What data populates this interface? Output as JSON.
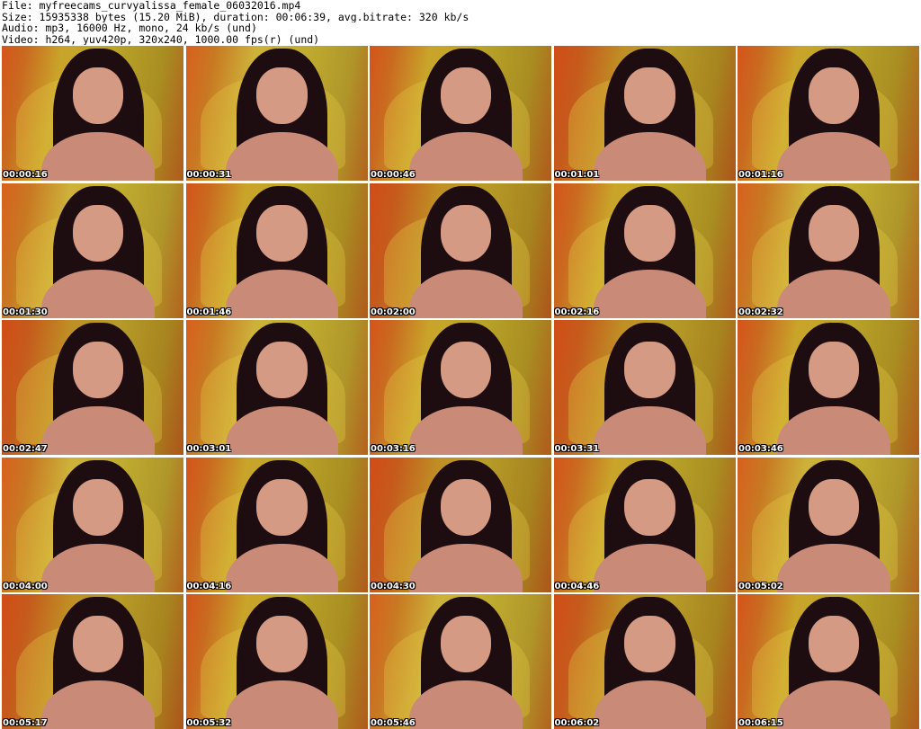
{
  "header": {
    "file_line": "File: myfreecams_curvyalissa_female_06032016.mp4",
    "size_line": "Size: 15935338 bytes (15.20 MiB), duration: 00:06:39, avg.bitrate: 320 kb/s",
    "audio_line": "Audio: mp3, 16000 Hz, mono, 24 kb/s (und)",
    "video_line": "Video: h264, yuv420p, 320x240, 1000.00 fps(r) (und)"
  },
  "thumbnails": [
    "00:00:16",
    "00:00:31",
    "00:00:46",
    "00:01:01",
    "00:01:16",
    "00:01:30",
    "00:01:46",
    "00:02:00",
    "00:02:16",
    "00:02:32",
    "00:02:47",
    "00:03:01",
    "00:03:16",
    "00:03:31",
    "00:03:46",
    "00:04:00",
    "00:04:16",
    "00:04:30",
    "00:04:46",
    "00:05:02",
    "00:05:17",
    "00:05:32",
    "00:05:46",
    "00:06:02",
    "00:06:15"
  ]
}
